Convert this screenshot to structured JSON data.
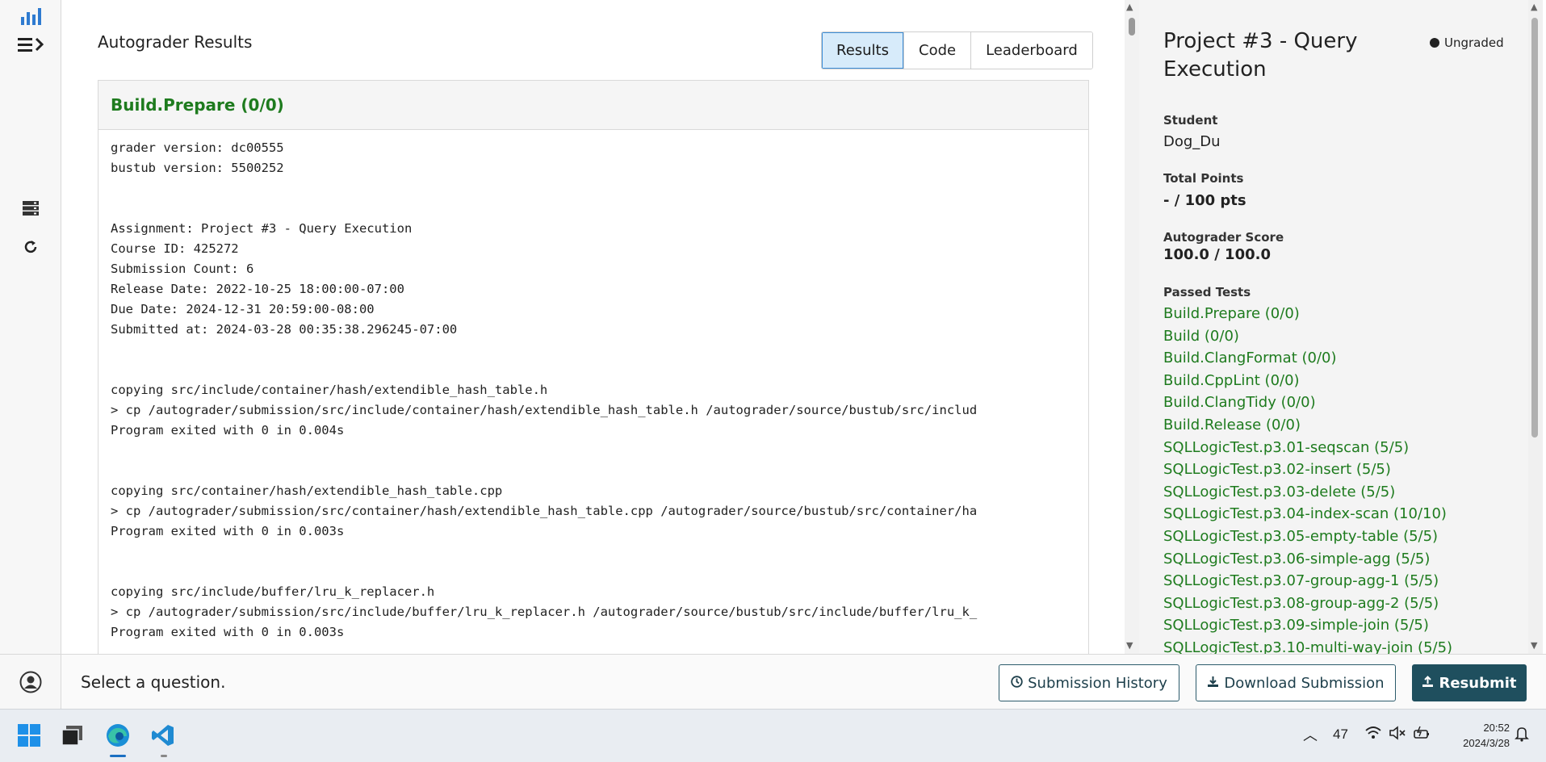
{
  "main": {
    "title": "Autograder Results",
    "tabs": [
      {
        "label": "Results",
        "active": true
      },
      {
        "label": "Code",
        "active": false
      },
      {
        "label": "Leaderboard",
        "active": false
      }
    ],
    "panel_title": "Build.Prepare (0/0)",
    "console_lines": [
      "grader version: dc00555",
      "bustub version: 5500252",
      "",
      "",
      "Assignment: Project #3 - Query Execution",
      "Course ID: 425272",
      "Submission Count: 6",
      "Release Date: 2022-10-25 18:00:00-07:00",
      "Due Date: 2024-12-31 20:59:00-08:00",
      "Submitted at: 2024-03-28 00:35:38.296245-07:00",
      "",
      "",
      "copying src/include/container/hash/extendible_hash_table.h",
      "> cp /autograder/submission/src/include/container/hash/extendible_hash_table.h /autograder/source/bustub/src/includ",
      "Program exited with 0 in 0.004s",
      "",
      "",
      "copying src/container/hash/extendible_hash_table.cpp",
      "> cp /autograder/submission/src/container/hash/extendible_hash_table.cpp /autograder/source/bustub/src/container/ha",
      "Program exited with 0 in 0.003s",
      "",
      "",
      "copying src/include/buffer/lru_k_replacer.h",
      "> cp /autograder/submission/src/include/buffer/lru_k_replacer.h /autograder/source/bustub/src/include/buffer/lru_k_",
      "Program exited with 0 in 0.003s"
    ]
  },
  "sidebar": {
    "project_title": "Project #3 - Query Execution",
    "status": "Ungraded",
    "student_label": "Student",
    "student_value": "Dog_Du",
    "total_points_label": "Total Points",
    "total_points_value": "- / 100 pts",
    "autograder_score_label": "Autograder Score",
    "autograder_score_value": "100.0 / 100.0",
    "passed_tests_label": "Passed Tests",
    "passed_tests": [
      "Build.Prepare (0/0)",
      "Build (0/0)",
      "Build.ClangFormat (0/0)",
      "Build.CppLint (0/0)",
      "Build.ClangTidy (0/0)",
      "Build.Release (0/0)",
      "SQLLogicTest.p3.01-seqscan (5/5)",
      "SQLLogicTest.p3.02-insert (5/5)",
      "SQLLogicTest.p3.03-delete (5/5)",
      "SQLLogicTest.p3.04-index-scan (10/10)",
      "SQLLogicTest.p3.05-empty-table (5/5)",
      "SQLLogicTest.p3.06-simple-agg (5/5)",
      "SQLLogicTest.p3.07-group-agg-1 (5/5)",
      "SQLLogicTest.p3.08-group-agg-2 (5/5)",
      "SQLLogicTest.p3.09-simple-join (5/5)",
      "SQLLogicTest.p3.10-multi-way-join (5/5)"
    ]
  },
  "footer": {
    "select_question": "Select a question.",
    "submission_history": "Submission History",
    "download_submission": "Download Submission",
    "resubmit": "Resubmit"
  },
  "taskbar": {
    "temperature": "47",
    "time": "20:52",
    "date": "2024/3/28"
  },
  "colors": {
    "pass_green": "#1e7b1e",
    "accent_teal": "#1f4f5e",
    "active_tab_bg": "#d7ebfa"
  }
}
